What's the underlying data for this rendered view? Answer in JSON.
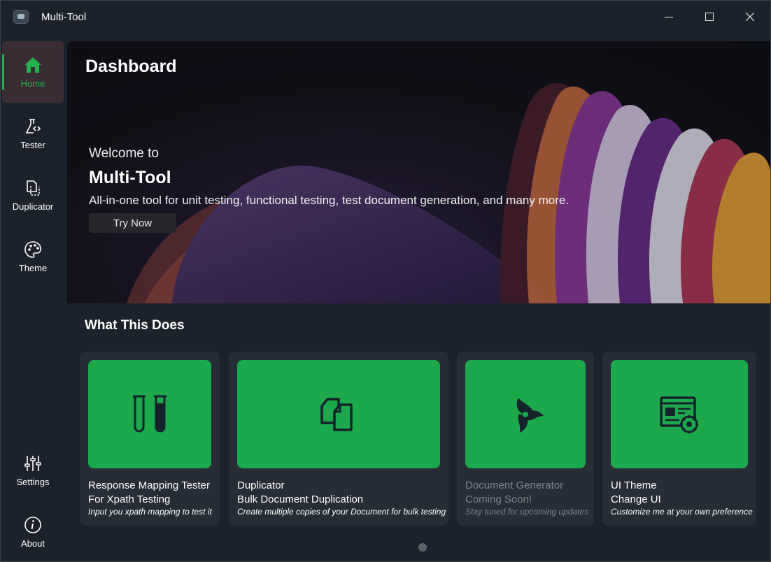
{
  "window": {
    "title": "Multi-Tool"
  },
  "sidebar": {
    "items": [
      {
        "label": "Home",
        "icon": "home-icon",
        "active": true
      },
      {
        "label": "Tester",
        "icon": "flask-code-icon"
      },
      {
        "label": "Duplicator",
        "icon": "duplicate-icon"
      },
      {
        "label": "Theme",
        "icon": "palette-icon"
      }
    ],
    "bottom": [
      {
        "label": "Settings",
        "icon": "sliders-icon"
      },
      {
        "label": "About",
        "icon": "info-icon"
      }
    ]
  },
  "hero": {
    "title": "Dashboard",
    "welcome": "Welcome to",
    "app_name": "Multi-Tool",
    "description": "All-in-one tool for unit testing, functional testing, test document generation, and many more.",
    "button": "Try Now"
  },
  "section": {
    "title": "What This Does"
  },
  "cards": [
    {
      "line1": "Response Mapping Tester",
      "line2": "For Xpath Testing",
      "line3": "Input you xpath mapping to test it",
      "icon": "test-tubes-icon"
    },
    {
      "line1": "Duplicator",
      "line2": "Bulk Document Duplication",
      "line3": "Create multiple copies of your Document for bulk testing",
      "icon": "copy-documents-icon"
    },
    {
      "line1": "Document Generator",
      "line2": "Coming Soon!",
      "line3": "Stay tuned for upcoming updates",
      "icon": "triskelion-icon",
      "disabled": true
    },
    {
      "line1": "UI Theme",
      "line2": "Change UI",
      "line3": "Customize me at your own preference",
      "icon": "window-settings-icon"
    }
  ],
  "colors": {
    "accent": "#1ba94c",
    "background": "#1c222b",
    "card": "#262d36"
  }
}
